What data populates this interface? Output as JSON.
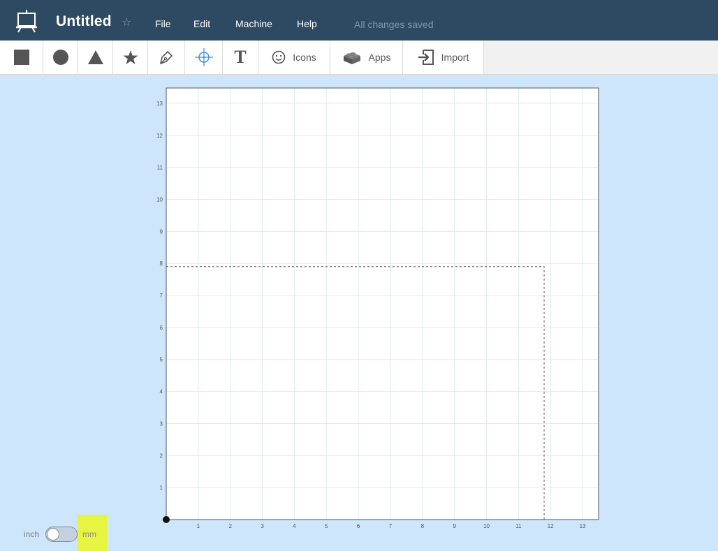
{
  "header": {
    "title": "Untitled",
    "star_icon": "star-outline-icon",
    "logo_icon": "easel-icon",
    "menu": [
      "File",
      "Edit",
      "Machine",
      "Help"
    ],
    "save_status": "All changes saved",
    "background_color": "#2d4a62"
  },
  "toolbar": {
    "tools": [
      {
        "name": "square-tool",
        "icon": "square-icon"
      },
      {
        "name": "circle-tool",
        "icon": "circle-icon"
      },
      {
        "name": "triangle-tool",
        "icon": "triangle-icon"
      },
      {
        "name": "star-tool",
        "icon": "star-icon"
      },
      {
        "name": "pen-tool",
        "icon": "pen-icon"
      },
      {
        "name": "point-tool",
        "icon": "crosshair-icon"
      },
      {
        "name": "text-tool",
        "icon": "text-T-icon"
      }
    ],
    "icons_label": "Icons",
    "apps_label": "Apps",
    "import_label": "Import"
  },
  "canvas": {
    "x_ticks": [
      "1",
      "2",
      "3",
      "4",
      "5",
      "6",
      "7",
      "8",
      "9",
      "10",
      "11",
      "12",
      "13"
    ],
    "y_ticks": [
      "1",
      "2",
      "3",
      "4",
      "5",
      "6",
      "7",
      "8",
      "9",
      "10",
      "11",
      "12",
      "13"
    ],
    "range": [
      0,
      13.5
    ],
    "workarea": {
      "width": 11.8,
      "height": 7.9
    },
    "background_color": "#cde6fb",
    "grid_color": "#dcebf8"
  },
  "units": {
    "inch_label": "inch",
    "mm_label": "mm",
    "selected": "inch"
  }
}
